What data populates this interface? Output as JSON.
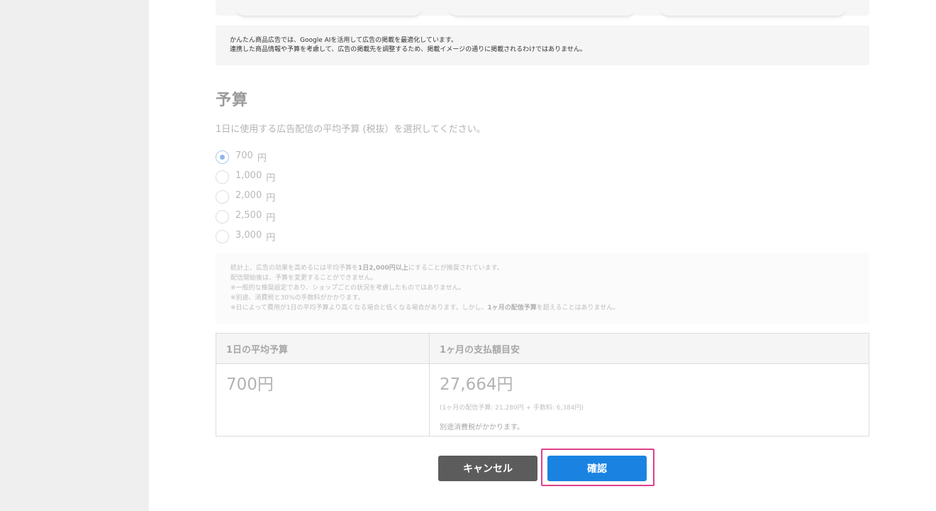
{
  "notice": {
    "line1": "かんたん商品広告では、Google AIを活用して広告の掲載を最適化しています。",
    "line2": "連携した商品情報や予算を考慮して、広告の掲載先を調整するため、掲載イメージの通りに掲載されるわけではありません。"
  },
  "budget": {
    "title": "予算",
    "description": "1日に使用する広告配信の平均予算 (税抜）を選択してください。",
    "options": [
      {
        "amount": "700",
        "unit": "円",
        "selected": true
      },
      {
        "amount": "1,000",
        "unit": "円",
        "selected": false
      },
      {
        "amount": "2,000",
        "unit": "円",
        "selected": false
      },
      {
        "amount": "2,500",
        "unit": "円",
        "selected": false
      },
      {
        "amount": "3,000",
        "unit": "円",
        "selected": false
      }
    ]
  },
  "stats": {
    "line1_pre": "統計上、広告の効果を高めるには平均予算を",
    "line1_bold": "1日2,000円以上",
    "line1_post": "にすることが推奨されています。",
    "line2": "配信開始後は、予算を変更することができません。",
    "line3": "※一般的な推奨設定であり、ショップごとの状況を考慮したものではありません。",
    "line4": "※別途、消費税と30%の手数料がかかります。",
    "line5_pre": "※日によって費用が1日の平均予算より高くなる場合と低くなる場合があります。しかし、",
    "line5_bold": "1ヶ月の配信予算",
    "line5_post": "を超えることはありません。"
  },
  "table": {
    "header_daily": "1日の平均予算",
    "header_monthly": "1ヶ月の支払額目安",
    "daily_value": "700円",
    "monthly_value": "27,664円",
    "breakdown": "(1ヶ月の配信予算: 21,280円 + 手数料: 6,384円)",
    "tax_note": "別途消費税がかかります。"
  },
  "buttons": {
    "cancel": "キャンセル",
    "confirm": "確認"
  }
}
